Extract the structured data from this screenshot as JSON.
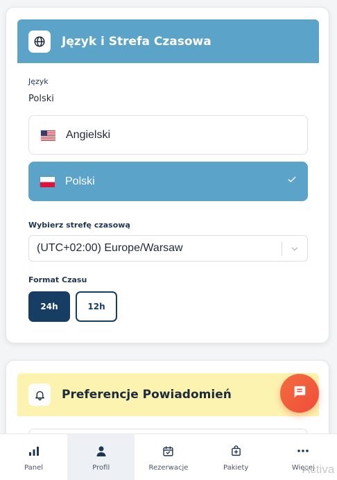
{
  "language_card": {
    "title": "Język i Strefa Czasowa",
    "icon": "globe-icon",
    "language_label": "Język",
    "current_language": "Polski",
    "options": [
      {
        "label": "Angielski",
        "flag": "us-flag-icon",
        "selected": false
      },
      {
        "label": "Polski",
        "flag": "pl-flag-icon",
        "selected": true
      }
    ],
    "timezone_label": "Wybierz strefę czasową",
    "timezone_value": "(UTC+02:00) Europe/Warsaw",
    "time_format_label": "Format Czasu",
    "time_formats": [
      {
        "label": "24h",
        "selected": true
      },
      {
        "label": "12h",
        "selected": false
      }
    ]
  },
  "notifications_card": {
    "title": "Preferencje Powiadomień",
    "icon": "bell-icon"
  },
  "chat_button": {
    "icon": "chat-icon"
  },
  "bottom_nav": {
    "items": [
      {
        "label": "Panel",
        "icon": "bar-chart-icon",
        "active": false
      },
      {
        "label": "Profil",
        "icon": "user-icon",
        "active": true
      },
      {
        "label": "Rezerwacje",
        "icon": "calendar-check-icon",
        "active": false
      },
      {
        "label": "Pakiety",
        "icon": "package-plus-icon",
        "active": false
      },
      {
        "label": "Więcej",
        "icon": "more-icon",
        "active": false
      }
    ]
  },
  "watermark": "Activa",
  "colors": {
    "primary_blue": "#5ba3c9",
    "dark_navy": "#173d62",
    "notif_yellow": "#fdf3b0",
    "fab_orange": "#ef4d3c"
  }
}
